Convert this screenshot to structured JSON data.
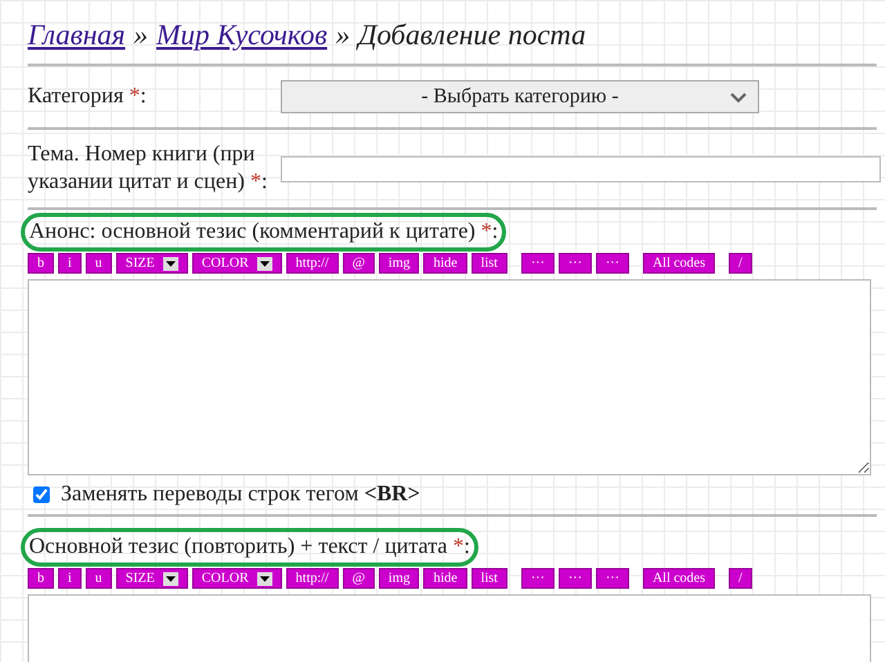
{
  "breadcrumb": {
    "links": [
      "Главная",
      "Мир Кусочков"
    ],
    "separator": "»",
    "current": "Добавление поста"
  },
  "category": {
    "label": "Категория",
    "required": "*",
    "suffix": ":",
    "value": "- Выбрать категорию -"
  },
  "topic": {
    "label": "Тема. Номер книги (при указании цитат и сцен)",
    "required": "*",
    "suffix": ":"
  },
  "editors": [
    {
      "label": "Анонс: основной тезис (комментарий к цитате)",
      "required": "*",
      "suffix": ":",
      "annotated": true,
      "toolbar": [
        {
          "label": "b",
          "kind": "button"
        },
        {
          "label": "i",
          "kind": "button"
        },
        {
          "label": "u",
          "kind": "button"
        },
        {
          "label": "SIZE",
          "kind": "dropdown"
        },
        {
          "label": "COLOR",
          "kind": "dropdown"
        },
        {
          "label": "http://",
          "kind": "button"
        },
        {
          "label": "@",
          "kind": "button"
        },
        {
          "label": "img",
          "kind": "button"
        },
        {
          "label": "hide",
          "kind": "button"
        },
        {
          "label": "list",
          "kind": "button"
        },
        {
          "label": "···",
          "kind": "gap-button"
        },
        {
          "label": "···",
          "kind": "button"
        },
        {
          "label": "···",
          "kind": "button"
        },
        {
          "label": "All codes",
          "kind": "gap-button"
        },
        {
          "label": "/",
          "kind": "gap-button"
        }
      ],
      "checkbox": {
        "label": "Заменять переводы строк тегом **<BR>**",
        "checked": true
      }
    },
    {
      "label": "Основной тезис (повторить) + текст / цитата",
      "required": "*",
      "suffix": ":",
      "annotated": true,
      "toolbar": [
        {
          "label": "b",
          "kind": "button"
        },
        {
          "label": "i",
          "kind": "button"
        },
        {
          "label": "u",
          "kind": "button"
        },
        {
          "label": "SIZE",
          "kind": "dropdown"
        },
        {
          "label": "COLOR",
          "kind": "dropdown"
        },
        {
          "label": "http://",
          "kind": "button"
        },
        {
          "label": "@",
          "kind": "button"
        },
        {
          "label": "img",
          "kind": "button"
        },
        {
          "label": "hide",
          "kind": "button"
        },
        {
          "label": "list",
          "kind": "button"
        },
        {
          "label": "···",
          "kind": "gap-button"
        },
        {
          "label": "···",
          "kind": "button"
        },
        {
          "label": "···",
          "kind": "button"
        },
        {
          "label": "All codes",
          "kind": "gap-button"
        },
        {
          "label": "/",
          "kind": "gap-button"
        }
      ]
    }
  ]
}
